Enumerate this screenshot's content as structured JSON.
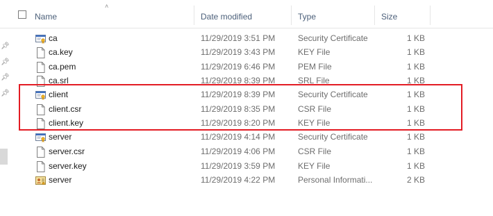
{
  "columns": {
    "name": "Name",
    "date": "Date modified",
    "type": "Type",
    "size": "Size"
  },
  "files": [
    {
      "name": "ca",
      "date": "11/29/2019 3:51 PM",
      "type": "Security Certificate",
      "size": "1 KB",
      "icon": "certificate-icon"
    },
    {
      "name": "ca.key",
      "date": "11/29/2019 3:43 PM",
      "type": "KEY File",
      "size": "1 KB",
      "icon": "file-icon"
    },
    {
      "name": "ca.pem",
      "date": "11/29/2019 6:46 PM",
      "type": "PEM File",
      "size": "1 KB",
      "icon": "file-icon"
    },
    {
      "name": "ca.srl",
      "date": "11/29/2019 8:39 PM",
      "type": "SRL File",
      "size": "1 KB",
      "icon": "file-icon"
    },
    {
      "name": "client",
      "date": "11/29/2019 8:39 PM",
      "type": "Security Certificate",
      "size": "1 KB",
      "icon": "certificate-icon"
    },
    {
      "name": "client.csr",
      "date": "11/29/2019 8:35 PM",
      "type": "CSR File",
      "size": "1 KB",
      "icon": "file-icon"
    },
    {
      "name": "client.key",
      "date": "11/29/2019 8:20 PM",
      "type": "KEY File",
      "size": "1 KB",
      "icon": "file-icon"
    },
    {
      "name": "server",
      "date": "11/29/2019 4:14 PM",
      "type": "Security Certificate",
      "size": "1 KB",
      "icon": "certificate-icon"
    },
    {
      "name": "server.csr",
      "date": "11/29/2019 4:06 PM",
      "type": "CSR File",
      "size": "1 KB",
      "icon": "file-icon"
    },
    {
      "name": "server.key",
      "date": "11/29/2019 3:59 PM",
      "type": "KEY File",
      "size": "1 KB",
      "icon": "file-icon"
    },
    {
      "name": "server",
      "date": "11/29/2019 4:22 PM",
      "type": "Personal Informati...",
      "size": "2 KB",
      "icon": "personal-information-icon"
    }
  ],
  "colors": {
    "highlight": "#e31b23",
    "header_text": "#4c607a"
  }
}
